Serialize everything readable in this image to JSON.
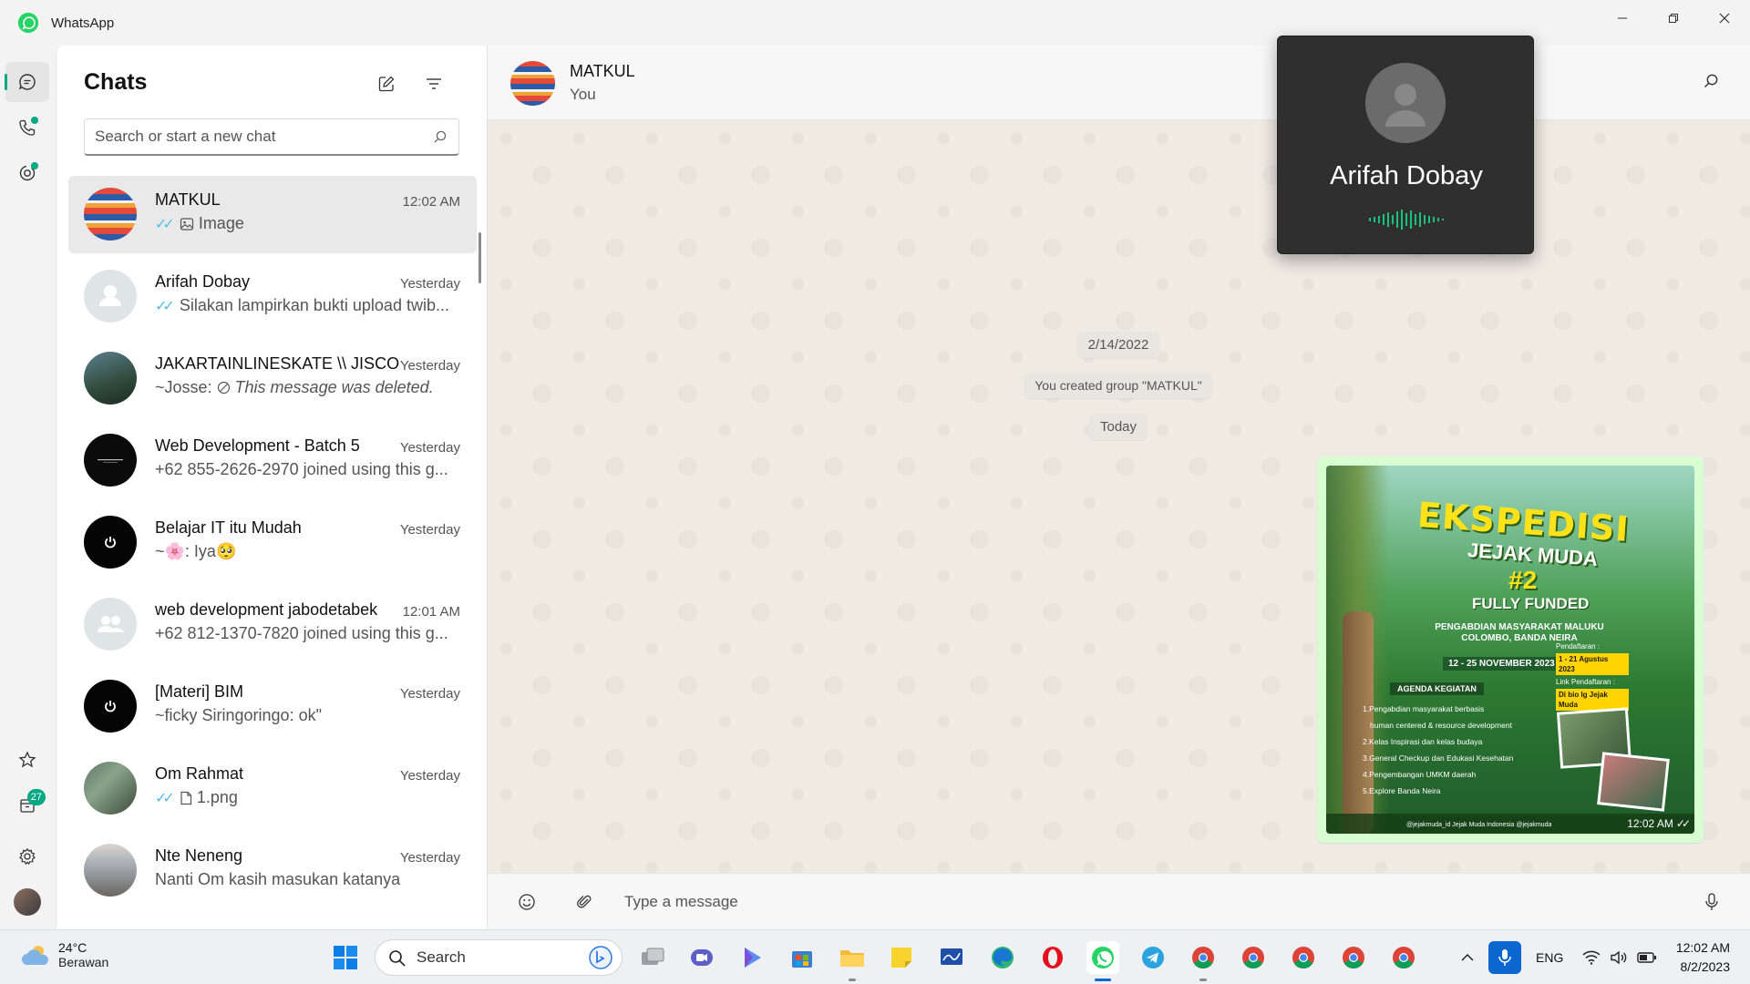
{
  "window": {
    "title": "WhatsApp",
    "controls": [
      "minimize",
      "restore",
      "close"
    ]
  },
  "rail": {
    "top": [
      {
        "name": "chats-icon",
        "active": true
      },
      {
        "name": "calls-icon",
        "dot": true
      },
      {
        "name": "status-icon",
        "dot": true
      }
    ],
    "bottom": [
      {
        "name": "starred-icon"
      },
      {
        "name": "archive-icon",
        "badge": "27"
      },
      {
        "name": "settings-icon"
      },
      {
        "name": "profile-avatar"
      }
    ]
  },
  "chatlist": {
    "title": "Chats",
    "search_placeholder": "Search or start a new chat",
    "chats": [
      {
        "name": "MATKUL",
        "time": "12:02 AM",
        "preview": "Image",
        "tick": true,
        "kind": "image",
        "selected": true,
        "avatar": "matkul"
      },
      {
        "name": "Arifah Dobay",
        "time": "Yesterday",
        "preview": "Silakan lampirkan bukti upload twib...",
        "tick": true,
        "avatar": "default"
      },
      {
        "name": "JAKARTAINLINESKATE \\\\ JISCO",
        "time": "Yesterday",
        "preview_prefix": "~Josse: ",
        "preview": "This message was deleted.",
        "kind": "deleted",
        "avatar": "skate"
      },
      {
        "name": "Web Development - Batch 5",
        "time": "Yesterday",
        "preview": "+62 855-2626-2970 joined using this g...",
        "avatar": "black"
      },
      {
        "name": "Belajar IT itu Mudah",
        "time": "Yesterday",
        "preview": "~🌸: Iya🥺",
        "avatar": "power"
      },
      {
        "name": "web development jabodetabek",
        "time": "12:01 AM",
        "preview": "+62 812-1370-7820 joined using this g...",
        "avatar": "group"
      },
      {
        "name": "[Materi] BIM",
        "time": "Yesterday",
        "preview": "~ficky Siringoringo: ok\"",
        "avatar": "power"
      },
      {
        "name": "Om Rahmat",
        "time": "Yesterday",
        "preview": "1.png",
        "tick": true,
        "kind": "file",
        "avatar": "photo1"
      },
      {
        "name": "Nte Neneng",
        "time": "Yesterday",
        "preview": "Nanti Om kasih masukan katanya",
        "avatar": "photo2"
      }
    ]
  },
  "conversation": {
    "name": "MATKUL",
    "subtitle": "You",
    "date_pill": "2/14/2022",
    "system_msg": "You created group \"MATKUL\"",
    "today_pill": "Today",
    "image_message": {
      "time": "12:02 AM",
      "poster": {
        "title1": "EKSPEDISI",
        "title2": "JEJAK MUDA",
        "number": "#2",
        "funded": "FULLY FUNDED",
        "subtitle": "PENGABDIAN MASYARAKAT MALUKU COLOMBO, BANDA NEIRA",
        "date": "12 - 25 NOVEMBER 2023",
        "agenda_title": "AGENDA KEGIATAN",
        "agenda": [
          "1.Pengabdian masyarakat berbasis",
          "human centered & resource development",
          "2.Kelas Inspirasi dan kelas budaya",
          "3.General Checkup dan Edukasi Kesehatan",
          "4.Pengembangan UMKM daerah",
          "5.Explore Banda Neira"
        ],
        "reg_label": "Pendaftaran :",
        "reg_dates": "1 - 21 Agustus 2023",
        "link_label": "Link Pendaftaran :",
        "link_value": "Di bio Ig Jejak Muda",
        "footer": "@jejakmuda_id   Jejak Muda Indonesia   @jejakmuda"
      }
    },
    "composer_placeholder": "Type a message"
  },
  "call": {
    "name": "Arifah Dobay"
  },
  "taskbar": {
    "weather_temp": "24°C",
    "weather_cond": "Berawan",
    "search_label": "Search",
    "lang": "ENG",
    "time": "12:02 AM",
    "date": "8/2/2023"
  }
}
